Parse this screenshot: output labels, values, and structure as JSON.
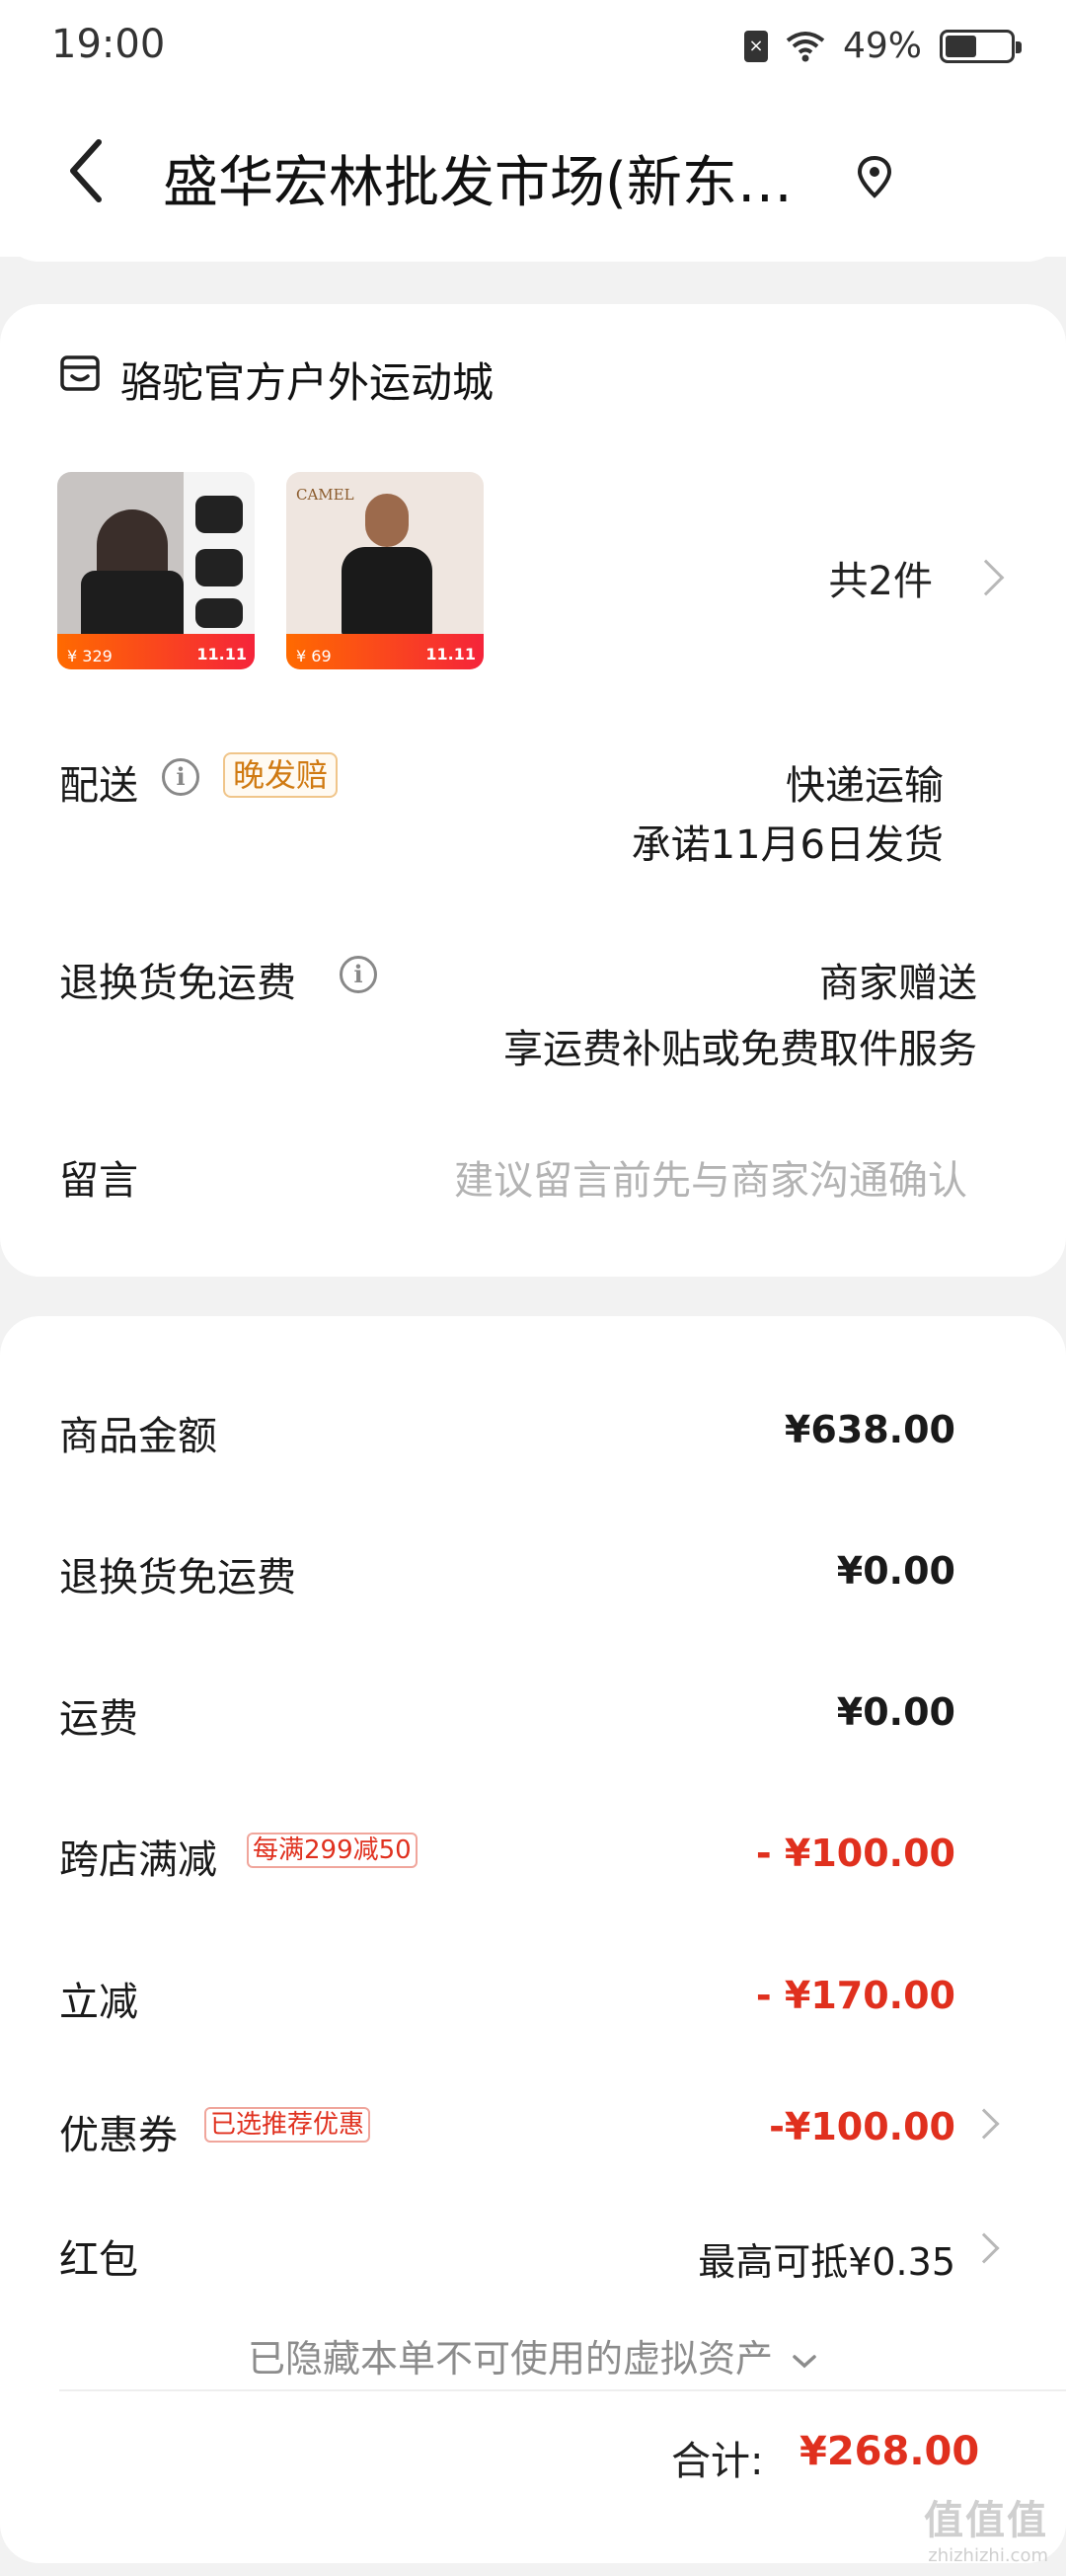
{
  "status_bar": {
    "time": "19:00",
    "battery_percent": "49%",
    "battery_level": 0.49,
    "icons": [
      "sim-error-icon",
      "wifi-icon",
      "battery-icon"
    ]
  },
  "header": {
    "title": "盛华宏林批发市场(新东…",
    "back_icon": "chevron-left-icon",
    "location_icon": "location-pin-icon"
  },
  "order": {
    "store_name": "骆驼官方户外运动城",
    "store_icon": "store-icon",
    "products": [
      {
        "price": "¥ 329",
        "tag": "11.11"
      },
      {
        "price": "¥ 69",
        "tag": "11.11",
        "brand": "CAMEL"
      }
    ],
    "item_count": "共2件",
    "delivery": {
      "label": "配送",
      "tag": "晚发赔",
      "method": "快递运输",
      "promise": "承诺11月6日发货"
    },
    "return_shipping": {
      "label": "退换货免运费",
      "value": "商家赠送",
      "detail": "享运费补贴或免费取件服务"
    },
    "message": {
      "label": "留言",
      "placeholder": "建议留言前先与商家沟通确认"
    }
  },
  "summary": {
    "goods_amount": {
      "label": "商品金额",
      "value": "¥638.00"
    },
    "return_fee": {
      "label": "退换货免运费",
      "value": "¥0.00"
    },
    "shipping": {
      "label": "运费",
      "value": "¥0.00"
    },
    "cross_store": {
      "label": "跨店满减",
      "tag": "每满299减50",
      "value": "- ¥100.00"
    },
    "instant_discount": {
      "label": "立减",
      "value": "- ¥170.00"
    },
    "coupon": {
      "label": "优惠券",
      "tag": "已选推荐优惠",
      "value": "-¥100.00"
    },
    "red_packet": {
      "label": "红包",
      "value": "最高可抵¥0.35"
    },
    "hidden_assets": "已隐藏本单不可使用的虚拟资产",
    "total_label": "合计:",
    "total_value": "¥268.00"
  },
  "watermark": {
    "main": "值值值",
    "sub": "zhizhizhi.com"
  },
  "colors": {
    "accent_red": "#e0301e",
    "tag_orange": "#d07a12",
    "background": "#f2f2f2"
  }
}
